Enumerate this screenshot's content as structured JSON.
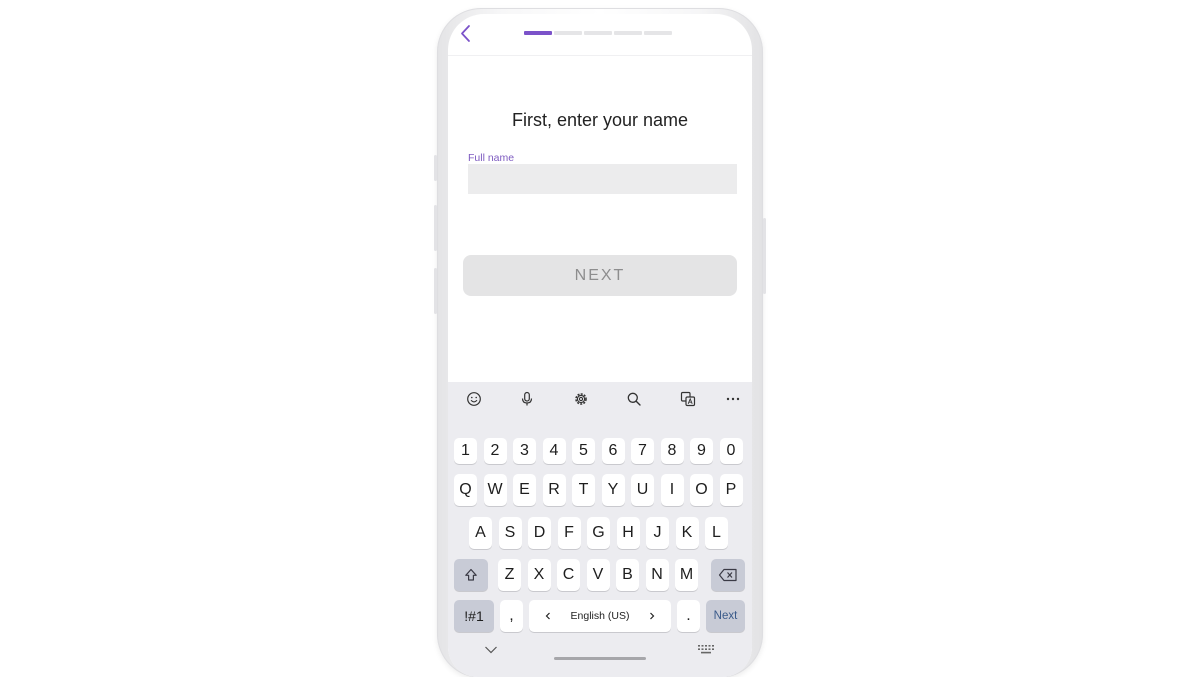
{
  "screen": {
    "title": "First, enter your name",
    "field_label": "Full name",
    "field_value": "",
    "next_label": "NEXT",
    "progress": {
      "total_steps": 5,
      "current_step": 1
    }
  },
  "colors": {
    "accent": "#7b52c9",
    "disabled_button": "#e4e4e5",
    "keyboard_bg": "#ececf0"
  },
  "keyboard": {
    "toolbar_icons": [
      "emoji-icon",
      "mic-icon",
      "settings-icon",
      "search-icon",
      "translate-icon",
      "more-icon"
    ],
    "row_numbers": [
      "1",
      "2",
      "3",
      "4",
      "5",
      "6",
      "7",
      "8",
      "9",
      "0"
    ],
    "row_q": [
      "Q",
      "W",
      "E",
      "R",
      "T",
      "Y",
      "U",
      "I",
      "O",
      "P"
    ],
    "row_a": [
      "A",
      "S",
      "D",
      "F",
      "G",
      "H",
      "J",
      "K",
      "L"
    ],
    "row_z": [
      "Z",
      "X",
      "C",
      "V",
      "B",
      "N",
      "M"
    ],
    "symbols_label": "!#1",
    "comma_label": ",",
    "language_label": "English (US)",
    "period_label": ".",
    "next_key_label": "Next"
  }
}
